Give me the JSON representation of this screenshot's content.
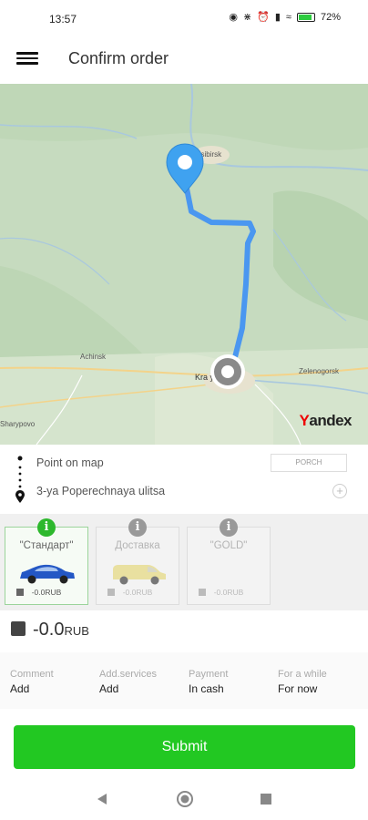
{
  "status_bar": {
    "time": "13:57",
    "battery": "72%"
  },
  "header": {
    "title": "Confirm order",
    "menu_icon": "hamburger-menu-icon"
  },
  "map": {
    "labels": {
      "top_city": "osibirsk",
      "achinsk": "Achinsk",
      "krasnoyarsk": "Kra   yarsk",
      "zelenogorsk": "Zelenogorsk",
      "sharypovo": "Sharypovo"
    },
    "brand_prefix": "Y",
    "brand_rest": "andex",
    "route_color": "#4a97f0"
  },
  "route": {
    "from": "Point on map",
    "to": "3-ya Poperechnaya ulitsa",
    "porch_label": "PORCH",
    "add_icon": "plus-circle-icon"
  },
  "tariffs": [
    {
      "name": "\"Стандарт\"",
      "price": "-0.0RUB",
      "active": true
    },
    {
      "name": "Доставка",
      "price": "-0.0RUB",
      "active": false
    },
    {
      "name": "\"GOLD\"",
      "price": "-0.0RUB",
      "active": false
    }
  ],
  "total": {
    "amount": "-0.0",
    "currency": "RUB"
  },
  "options": [
    {
      "label": "Comment",
      "value": "Add"
    },
    {
      "label": "Add.services",
      "value": "Add"
    },
    {
      "label": "Payment",
      "value": "In cash"
    },
    {
      "label": "For a while",
      "value": "For now"
    }
  ],
  "submit_label": "Submit",
  "colors": {
    "accent": "#22c822",
    "active_tariff_border": "#9bd49b"
  }
}
